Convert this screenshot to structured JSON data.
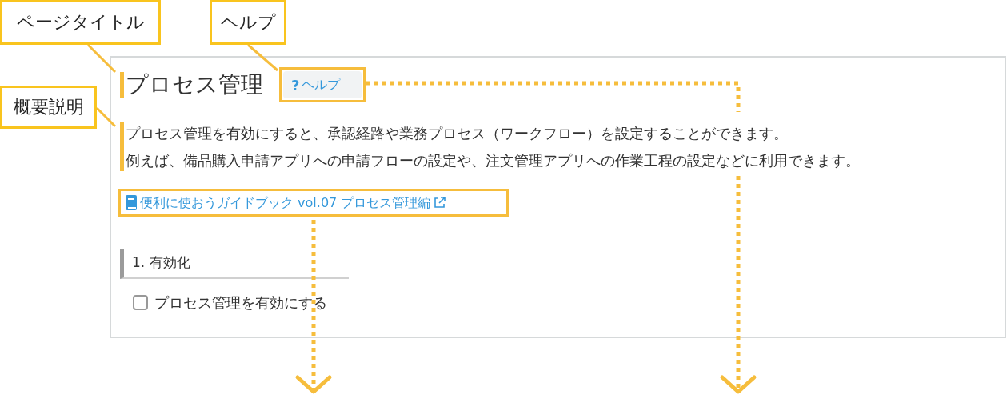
{
  "annotations": [
    {
      "label": "ページタイトル"
    },
    {
      "label": "ヘルプ"
    },
    {
      "label": "概要説明"
    }
  ],
  "page": {
    "title": "プロセス管理",
    "help_button": {
      "icon_text": "?",
      "label": "ヘルプ"
    },
    "description": [
      "プロセス管理を有効にすると、承認経路や業務プロセス（ワークフロー）を設定することができます。",
      "例えば、備品購入申請アプリへの申請フローの設定や、注文管理アプリへの作業工程の設定などに利用できます。"
    ],
    "guide_link": "便利に使おうガイドブック vol.07 プロセス管理編",
    "section": {
      "heading": "1. 有効化",
      "checkbox": {
        "label": "プロセス管理を有効にする",
        "checked": false
      }
    }
  }
}
